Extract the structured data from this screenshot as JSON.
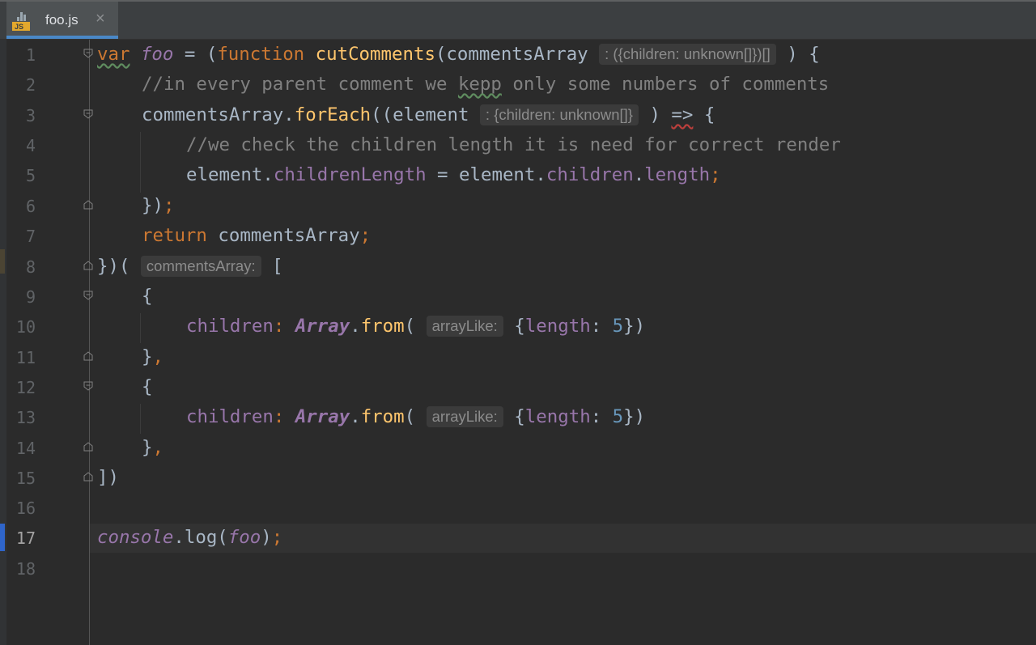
{
  "tab": {
    "title": "foo.js",
    "icon": "js-file-icon",
    "icon_label": "JS",
    "close_glyph": "×"
  },
  "colors": {
    "background": "#2b2b2b",
    "tab_active": "#4e5254",
    "tab_underline": "#4a88c7",
    "keyword": "#cc7832",
    "function": "#ffc66d",
    "property": "#9876aa",
    "number": "#6897bb",
    "comment": "#808080"
  },
  "editor": {
    "current_line": "17",
    "lines": [
      {
        "n": "1",
        "t": {
          "var": "var",
          "name": "foo",
          "eq": " = (",
          "function": "function",
          "fname": "cutComments",
          "open": "(commentsArray ",
          "hint": ": ({children: unknown[]})[]",
          "close": " ) {"
        }
      },
      {
        "n": "2",
        "t": {
          "c1": "//in every parent comment we ",
          "c2": "kepp",
          "c3": " only some numbers of comments"
        }
      },
      {
        "n": "3",
        "t": {
          "a": "commentsArray.",
          "b": "forEach",
          "c": "((element ",
          "hint": ": {children: unknown[]}",
          "d": " ) ",
          "e": "=>",
          "f": " {"
        }
      },
      {
        "n": "4",
        "t": {
          "c": "//we check the children length it is need for correct render"
        }
      },
      {
        "n": "5",
        "t": {
          "a": "element.",
          "b": "childrenLength",
          "c": " = element.",
          "d": "children",
          "e": ".",
          "f": "length",
          "g": ";"
        }
      },
      {
        "n": "6",
        "t": {
          "a": "})",
          "b": ";"
        }
      },
      {
        "n": "7",
        "t": {
          "a": "return",
          "b": " commentsArray",
          "c": ";"
        }
      },
      {
        "n": "8",
        "t": {
          "a": "})( ",
          "hint": "commentsArray:",
          "b": " ["
        }
      },
      {
        "n": "9",
        "t": {
          "a": "{"
        }
      },
      {
        "n": "10",
        "t": {
          "a": "children",
          "b": ": ",
          "c": "Array",
          "d": ".",
          "e": "from",
          "f": "( ",
          "hint": "arrayLike:",
          "g": " {",
          "h": "length",
          "i": ": ",
          "j": "5",
          "k": "})"
        }
      },
      {
        "n": "11",
        "t": {
          "a": "}",
          "b": ","
        }
      },
      {
        "n": "12",
        "t": {
          "a": "{"
        }
      },
      {
        "n": "13",
        "t": {
          "a": "children",
          "b": ": ",
          "c": "Array",
          "d": ".",
          "e": "from",
          "f": "( ",
          "hint": "arrayLike:",
          "g": " {",
          "h": "length",
          "i": ": ",
          "j": "5",
          "k": "})"
        }
      },
      {
        "n": "14",
        "t": {
          "a": "}",
          "b": ","
        }
      },
      {
        "n": "15",
        "t": {
          "a": "])"
        }
      },
      {
        "n": "16",
        "t": {}
      },
      {
        "n": "17",
        "t": {
          "a": "console",
          "b": ".log(",
          "c": "foo",
          "d": ")",
          "e": ";"
        }
      },
      {
        "n": "18",
        "t": {}
      }
    ]
  }
}
